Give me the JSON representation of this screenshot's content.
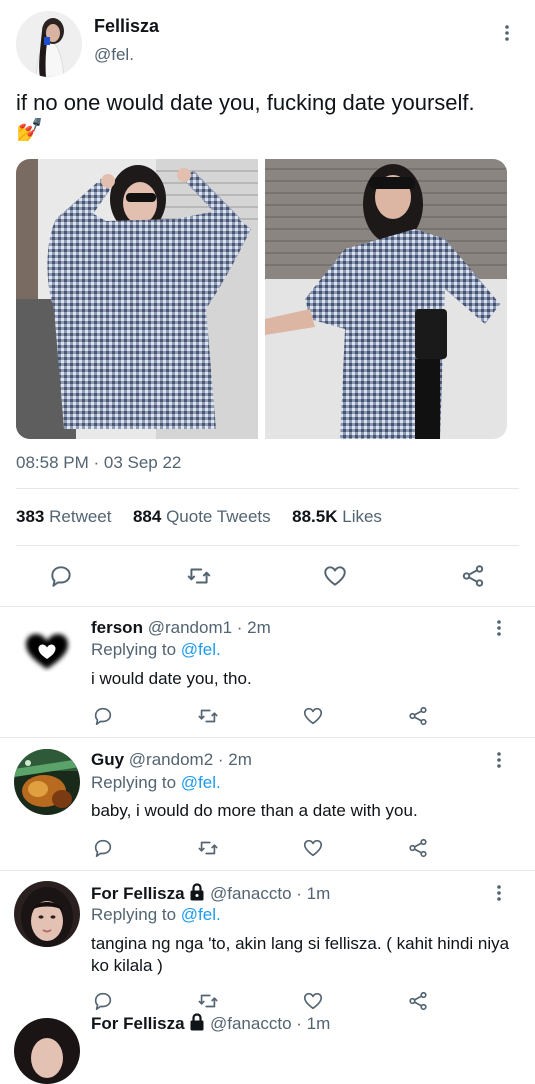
{
  "main_tweet": {
    "author_name": "Fellisza",
    "author_handle": "@fel.",
    "text": "if no one would date you, fucking date yourself.",
    "emoji": "💅",
    "timestamp": "08:58 PM · 03 Sep 22",
    "stats": {
      "retweets_count": "383",
      "retweets_label": "Retweet",
      "quotes_count": "884",
      "quotes_label": "Quote Tweets",
      "likes_count": "88.5K",
      "likes_label": "Likes"
    }
  },
  "replies": [
    {
      "name": "ferson",
      "handle": "@random1",
      "time": "· 2m",
      "replying_prefix": "Replying to",
      "replying_to": "@fel.",
      "text": "i would date you, tho."
    },
    {
      "name": "Guy",
      "handle": "@random2",
      "time": "· 2m",
      "replying_prefix": "Replying to",
      "replying_to": "@fel.",
      "text": "baby, i would do more than a date with you."
    },
    {
      "name": "For Fellisza",
      "handle": "@fanaccto",
      "time": "· 1m",
      "replying_prefix": "Replying to",
      "replying_to": "@fel.",
      "text": "tangina ng nga 'to, akin lang si fellisza. ( kahit hindi niya ko kilala )",
      "locked": true
    }
  ],
  "partial_reply": {
    "name": "For Fellisza",
    "handle": "@fanaccto",
    "time": "· 1m"
  },
  "colors": {
    "accent": "#1d9bf0",
    "muted": "#536471",
    "divider": "#e6e9ec"
  },
  "icons": [
    "more-icon",
    "reply-icon",
    "retweet-icon",
    "like-icon",
    "share-icon",
    "lock-icon",
    "heart-avatar-icon"
  ]
}
